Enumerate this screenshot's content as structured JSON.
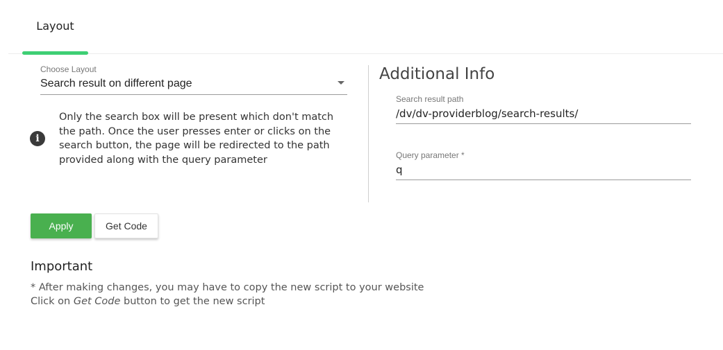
{
  "tabs": [
    {
      "label": "Layout",
      "active": true
    }
  ],
  "colors": {
    "accent": "#3ecf74",
    "apply": "#49b04f"
  },
  "layout_select": {
    "label": "Choose Layout",
    "value": "Search result on different page"
  },
  "info": {
    "icon": "info-icon",
    "text": "Only the search box will be present which don't match the path. Once the user presses enter or clicks on the search button, the page will be redirected to the path provided along with the query parameter"
  },
  "additional": {
    "title": "Additional Info",
    "search_path": {
      "label": "Search result path",
      "value": "/dv/dv-providerblog/search-results/"
    },
    "query_param": {
      "label": "Query parameter *",
      "value": "q"
    }
  },
  "buttons": {
    "apply": "Apply",
    "get_code": "Get Code"
  },
  "important": {
    "title": "Important",
    "line1": "* After making changes, you may have to copy the new script to your website",
    "line2_prefix": "Click on ",
    "line2_em": "Get Code",
    "line2_suffix": " button to get the new script"
  }
}
